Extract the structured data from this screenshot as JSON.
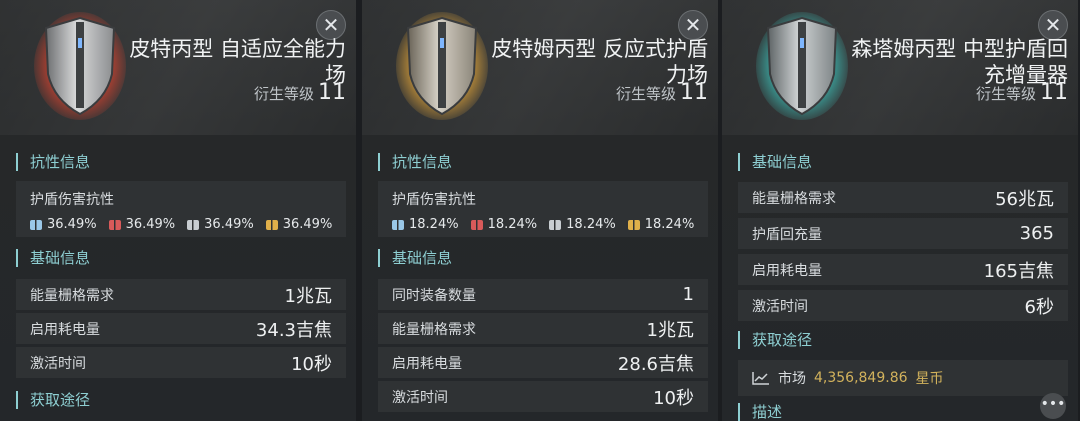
{
  "close_symbol": "✕",
  "panels": [
    {
      "accent": "#e2452f",
      "title": "皮特丙型 自适应全能力场",
      "level_label": "衍生等级",
      "level": "11",
      "resistance_section": "抗性信息",
      "resistance_label": "护盾伤害抗性",
      "resistances": [
        "36.49%",
        "36.49%",
        "36.49%",
        "36.49%"
      ],
      "basic_section": "基础信息",
      "stats": [
        {
          "label": "能量栅格需求",
          "value": "1兆瓦"
        },
        {
          "label": "启用耗电量",
          "value": "34.3吉焦"
        },
        {
          "label": "激活时间",
          "value": "10秒"
        }
      ],
      "acquire_section": "获取途径"
    },
    {
      "accent": "#e0a43a",
      "title": "皮特姆丙型 反应式护盾力场",
      "level_label": "衍生等级",
      "level": "11",
      "resistance_section": "抗性信息",
      "resistance_label": "护盾伤害抗性",
      "resistances": [
        "18.24%",
        "18.24%",
        "18.24%",
        "18.24%"
      ],
      "basic_section": "基础信息",
      "stats": [
        {
          "label": "同时装备数量",
          "value": "1"
        },
        {
          "label": "能量栅格需求",
          "value": "1兆瓦"
        },
        {
          "label": "启用耗电量",
          "value": "28.6吉焦"
        },
        {
          "label": "激活时间",
          "value": "10秒"
        }
      ]
    },
    {
      "accent": "#3fc6be",
      "title": "森塔姆丙型 中型护盾回充增量器",
      "level_label": "衍生等级",
      "level": "11",
      "basic_section": "基础信息",
      "stats": [
        {
          "label": "能量栅格需求",
          "value": "56兆瓦"
        },
        {
          "label": "护盾回充量",
          "value": "365"
        },
        {
          "label": "启用耗电量",
          "value": "165吉焦"
        },
        {
          "label": "激活时间",
          "value": "6秒"
        }
      ],
      "acquire_section": "获取途径",
      "market_label": "市场",
      "market_price": "4,356,849.86",
      "currency": "星币",
      "desc_section": "描述",
      "more_symbol": "•••"
    }
  ]
}
